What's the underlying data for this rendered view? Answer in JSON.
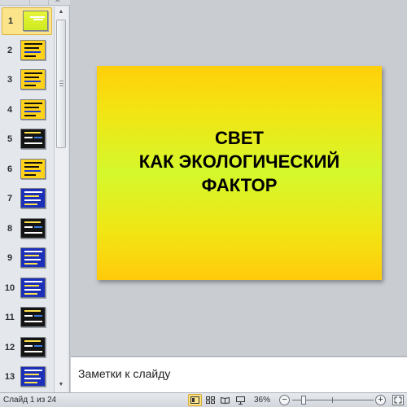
{
  "sidebar": {
    "thumbnails": [
      {
        "number": "1",
        "style": "t-green",
        "selected": true
      },
      {
        "number": "2",
        "style": "t-yellow"
      },
      {
        "number": "3",
        "style": "t-yellow"
      },
      {
        "number": "4",
        "style": "t-yellow"
      },
      {
        "number": "5",
        "style": "t-dark"
      },
      {
        "number": "6",
        "style": "t-yellow"
      },
      {
        "number": "7",
        "style": "t-blue"
      },
      {
        "number": "8",
        "style": "t-dark"
      },
      {
        "number": "9",
        "style": "t-blue"
      },
      {
        "number": "10",
        "style": "t-blue"
      },
      {
        "number": "11",
        "style": "t-dark"
      },
      {
        "number": "12",
        "style": "t-dark"
      },
      {
        "number": "13",
        "style": "t-blue"
      }
    ]
  },
  "slide": {
    "title_lines": [
      "СВЕТ",
      "КАК ЭКОЛОГИЧЕСКИЙ",
      "ФАКТОР"
    ]
  },
  "notes": {
    "placeholder": "Заметки к слайду"
  },
  "statusbar": {
    "slide_counter": "Слайд 1 из 24",
    "zoom": "36%",
    "zoom_value": 0.36
  },
  "colors": {
    "selected_highlight": "#fbe48a",
    "slide_yellow": "#ffcf0a",
    "slide_green": "#d4f82c"
  }
}
